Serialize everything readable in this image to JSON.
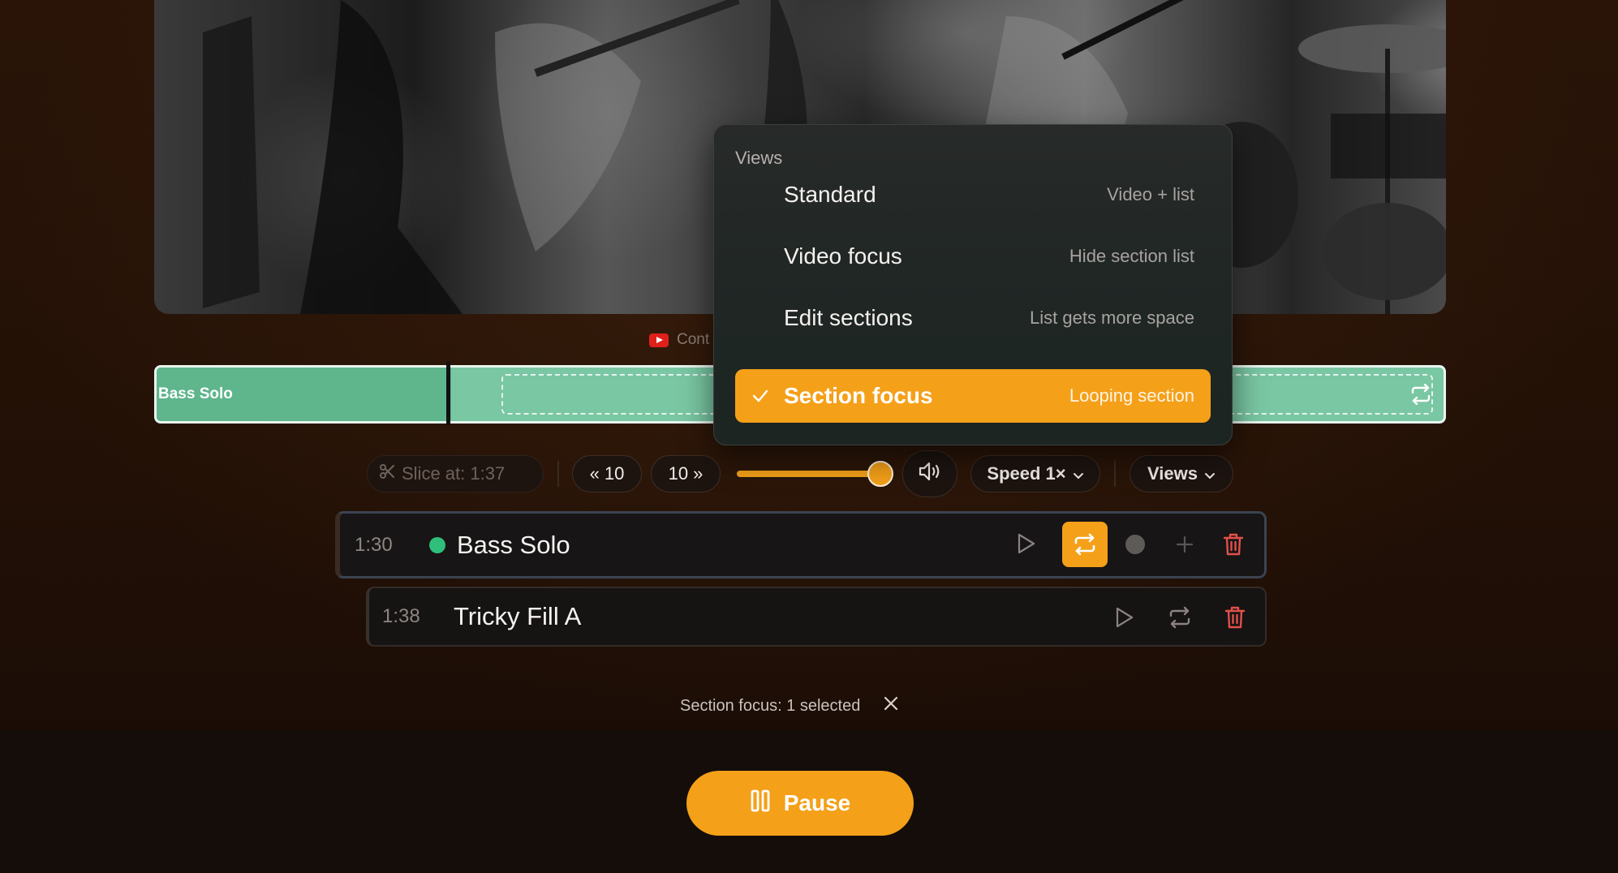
{
  "video": {
    "alt": "band-performance-video"
  },
  "source": {
    "label": "Cont"
  },
  "timeline": {
    "section_label": "Bass Solo"
  },
  "toolbar": {
    "slice_label": "Slice at: 1:37",
    "back_label": "« 10",
    "forward_label": "10 »",
    "volume_level": 0.88,
    "speed_label": "Speed 1×",
    "views_label": "Views"
  },
  "sections": [
    {
      "time": "1:30",
      "title": "Bass Solo",
      "active": true
    },
    {
      "time": "1:38",
      "title": "Tricky Fill A",
      "active": false
    }
  ],
  "status": {
    "text": "Section focus: 1 selected"
  },
  "pause": {
    "label": "Pause"
  },
  "views_menu": {
    "header": "Views",
    "items": [
      {
        "label": "Standard",
        "description": "Video + list",
        "selected": false
      },
      {
        "label": "Video focus",
        "description": "Hide section list",
        "selected": false
      },
      {
        "label": "Edit sections",
        "description": "List gets more space",
        "selected": false
      },
      {
        "label": "Section focus",
        "description": "Looping section",
        "selected": true
      }
    ]
  },
  "colors": {
    "accent": "#f4a019",
    "timeline": "#7ac7a3",
    "active_dot": "#2fbf7b",
    "delete": "#e2504a"
  }
}
